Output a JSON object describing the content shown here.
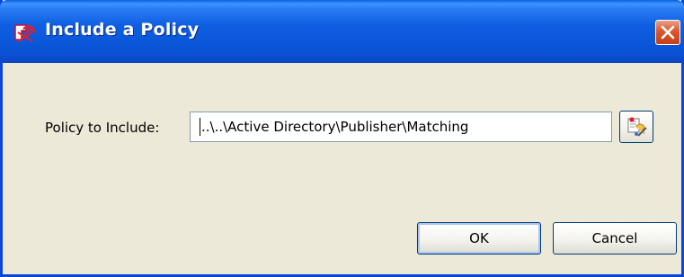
{
  "window": {
    "title": "Include a Policy",
    "title_icon": "policy-icon",
    "close_icon": "close-icon"
  },
  "form": {
    "label": "Policy to Include:",
    "path_value": "..\\..\\Active Directory\\Publisher\\Matching",
    "browse_icon": "browse-icon"
  },
  "buttons": {
    "ok": "OK",
    "cancel": "Cancel"
  },
  "colors": {
    "titlebar": "#0a57d8",
    "dialog_bg": "#ece9d8",
    "close_button": "#d9572c"
  }
}
